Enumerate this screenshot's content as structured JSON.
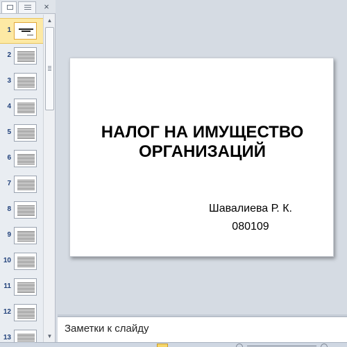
{
  "pane": {
    "close_label": "×",
    "tabs": [
      {
        "name": "slides-tab",
        "icon": "slides-icon"
      },
      {
        "name": "outline-tab",
        "icon": "outline-icon"
      }
    ]
  },
  "thumbnails": [
    {
      "number": "1",
      "selected": true,
      "kind": "title"
    },
    {
      "number": "2",
      "selected": false,
      "kind": "text"
    },
    {
      "number": "3",
      "selected": false,
      "kind": "text"
    },
    {
      "number": "4",
      "selected": false,
      "kind": "text"
    },
    {
      "number": "5",
      "selected": false,
      "kind": "text"
    },
    {
      "number": "6",
      "selected": false,
      "kind": "text"
    },
    {
      "number": "7",
      "selected": false,
      "kind": "text"
    },
    {
      "number": "8",
      "selected": false,
      "kind": "text"
    },
    {
      "number": "9",
      "selected": false,
      "kind": "text"
    },
    {
      "number": "10",
      "selected": false,
      "kind": "text"
    },
    {
      "number": "11",
      "selected": false,
      "kind": "text"
    },
    {
      "number": "12",
      "selected": false,
      "kind": "text"
    },
    {
      "number": "13",
      "selected": false,
      "kind": "text"
    }
  ],
  "slide": {
    "title_line1": "НАЛОГ НА ИМУЩЕСТВО",
    "title_line2": "ОРГАНИЗАЦИЙ",
    "author": "Шавалиева Р. К.",
    "code": "080109"
  },
  "notes": {
    "placeholder": "Заметки к слайду"
  },
  "colors": {
    "selected_thumb": "#fde9a4",
    "workspace": "#d5dbe3",
    "thumb_number": "#20407a"
  }
}
